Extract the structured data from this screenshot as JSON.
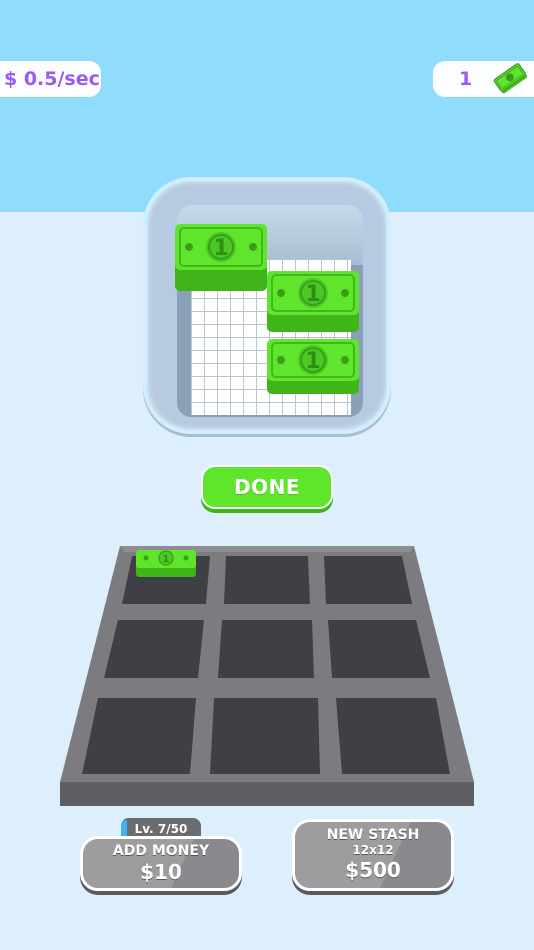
{
  "hud": {
    "rate": "$ 0.5/sec",
    "cash": "1",
    "cash_icon": "cash-stack-icon"
  },
  "stash_box": {
    "bills": [
      {
        "label": "1"
      },
      {
        "label": "1"
      },
      {
        "label": "1"
      }
    ]
  },
  "done_button": {
    "label": "DONE"
  },
  "board": {
    "rows": 3,
    "cols": 3,
    "filled_slot": "1"
  },
  "add_money": {
    "level": "Lv. 7/50",
    "label": "ADD MONEY",
    "price": "$10"
  },
  "new_stash": {
    "label": "NEW STASH",
    "size": "12x12",
    "price": "$500"
  },
  "colors": {
    "sky": "#8fdcfd",
    "accent_purple": "#9a5cf0",
    "money_green": "#5fe52c",
    "button_gray": "#9d9da0"
  }
}
